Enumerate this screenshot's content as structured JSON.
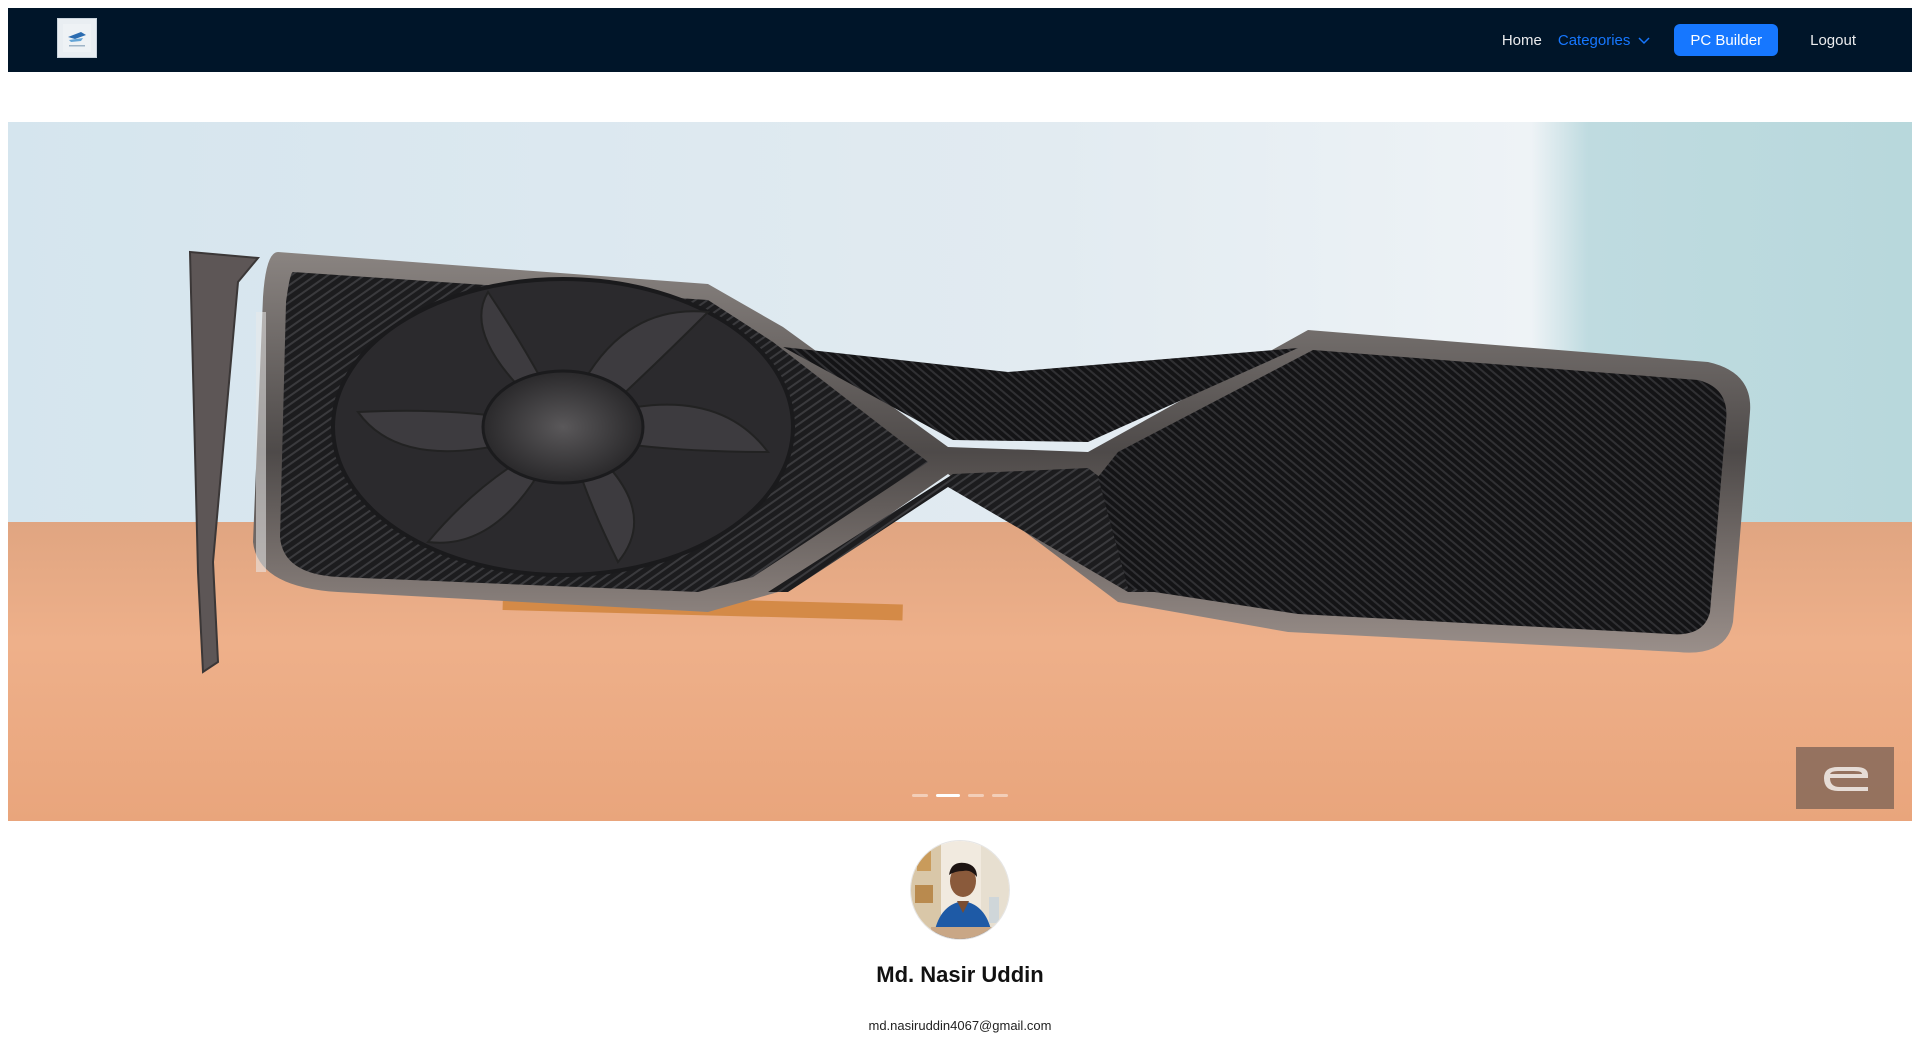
{
  "nav": {
    "home": "Home",
    "categories": "Categories",
    "pc_builder": "PC Builder",
    "logout": "Logout"
  },
  "carousel": {
    "slide_count": 4,
    "active_slide": 1
  },
  "profile": {
    "name": "Md. Nasir Uddin",
    "email": "md.nasiruddin4067@gmail.com"
  },
  "colors": {
    "navbar_bg": "#001529",
    "accent": "#1677ff"
  },
  "icons": {
    "categories_chevron": "chevron-down-icon",
    "watermark": "engadget-e-icon"
  }
}
